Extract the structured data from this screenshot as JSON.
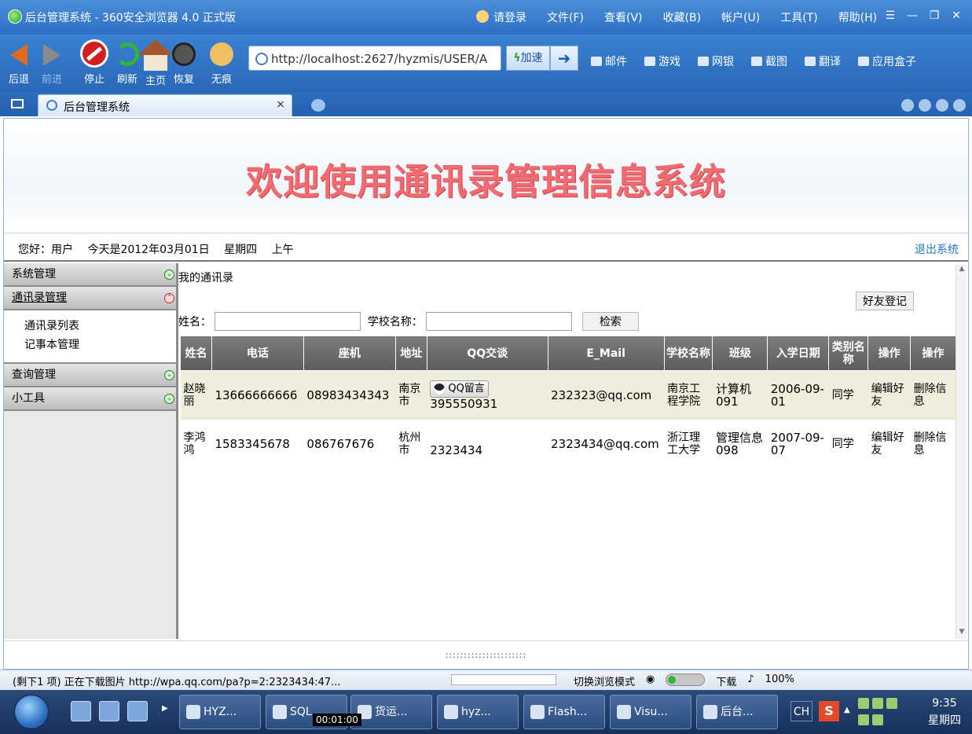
{
  "window": {
    "title": "后台管理系统 - 360安全浏览器 4.0 正式版",
    "menu": [
      "请登录",
      "文件(F)",
      "查看(V)",
      "收藏(B)",
      "帐户(U)",
      "工具(T)",
      "帮助(H)"
    ],
    "controls": [
      "☰",
      "—",
      "❐",
      "✕"
    ]
  },
  "toolbar": {
    "back": "后退",
    "forward": "前进",
    "stop": "停止",
    "refresh": "刷新",
    "home": "主页",
    "restore": "恢复",
    "noTrace": "无痕",
    "address": "http://localhost:2627/hyzmis/USER/A",
    "accelerate": "加速",
    "tools": [
      "邮件",
      "游戏",
      "网银",
      "截图",
      "翻译",
      "应用盒子"
    ]
  },
  "tab": {
    "label": "后台管理系统",
    "close": "×"
  },
  "page": {
    "banner": "欢迎使用通讯录管理信息系统",
    "greeting": "您好：用户",
    "date": "今天是2012年03月01日",
    "weekday": "星期四",
    "period": "上午",
    "logout": "退出系统"
  },
  "sidebar": {
    "sections": [
      {
        "label": "系统管理"
      },
      {
        "label": "通讯录管理",
        "items": [
          "通讯录列表",
          "记事本管理"
        ]
      },
      {
        "label": "查询管理"
      },
      {
        "label": "小工具"
      }
    ]
  },
  "content": {
    "heading": "我的通讯录",
    "addFriend": "好友登记",
    "search": {
      "nameLabel": "姓名：",
      "schoolLabel": "学校名称：",
      "button": "检索",
      "nameValue": "",
      "schoolValue": ""
    },
    "columns": [
      "姓名",
      "电话",
      "座机",
      "地址",
      "QQ交谈",
      "E_Mail",
      "学校名称",
      "班级",
      "入学日期",
      "类别名称",
      "操作",
      "操作"
    ],
    "rows": [
      {
        "name": "赵晓丽",
        "phone": "13666666666",
        "landline": "08983434343",
        "address": "南京市",
        "qqButton": "QQ留言",
        "qq": "395550931",
        "email": "232323@qq.com",
        "school": "南京工程学院",
        "class": "计算机091",
        "enrollDate": "2006-09-01",
        "category": "同学",
        "edit": "编辑好友",
        "delete": "删除信息"
      },
      {
        "name": "李鸿鸿",
        "phone": "1583345678",
        "landline": "086767676",
        "address": "杭州市",
        "qqButton": "",
        "qq": "2323434",
        "email": "2323434@qq.com",
        "school": "浙江理工大学",
        "class": "管理信息098",
        "enrollDate": "2007-09-07",
        "category": "同学",
        "edit": "编辑好友",
        "delete": "删除信息"
      }
    ],
    "divider": "::::::::::::::::::::::"
  },
  "status": {
    "message": "(剩下1 项) 正在下载图片 http://wpa.qq.com/pa?p=2:2323434:47...",
    "browseMode": "切换浏览模式",
    "download": "下载",
    "zoom": "100%"
  },
  "taskbar": {
    "buttons": [
      "HYZ...",
      "SQL ...",
      "货运...",
      "hyz...",
      "Flash...",
      "Visu...",
      "后台..."
    ],
    "timer": "00:01:00",
    "lang": "CH",
    "ime": "S",
    "time": "9:35",
    "day": "星期四"
  }
}
